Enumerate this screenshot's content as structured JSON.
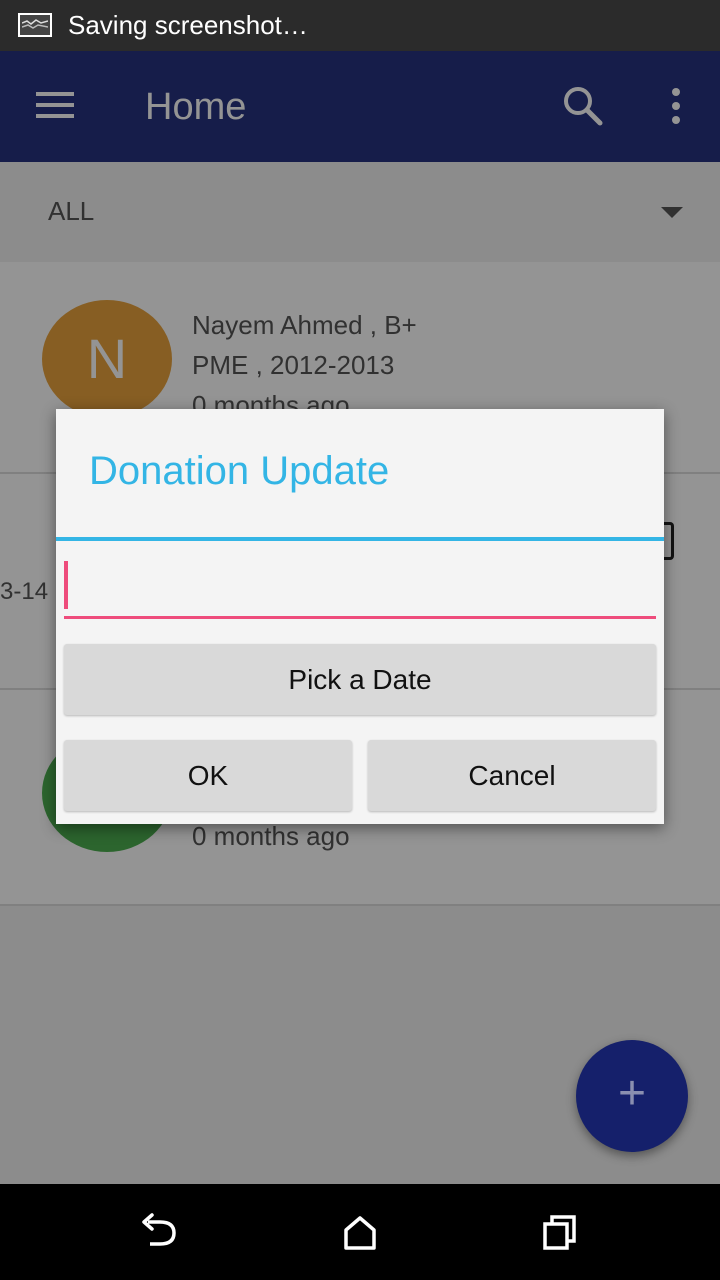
{
  "status_bar": {
    "text": "Saving screenshot…",
    "icon": "screenshot-icon"
  },
  "app_bar": {
    "title": "Home",
    "icons": [
      "menu-icon",
      "search-icon",
      "more-vert-icon"
    ],
    "color": "#263380"
  },
  "filter": {
    "label": "ALL"
  },
  "list": {
    "items": [
      {
        "initial": "N",
        "avatar_color": "#e8a33d",
        "line1": "Nayem Ahmed , B+",
        "line2": "PME , 2012-2013",
        "line3": "0 months  ago"
      },
      {
        "partial_text": "3-14"
      },
      {
        "avatar_color": "#4caf50",
        "line3": "0 months  ago"
      }
    ]
  },
  "dialog": {
    "title": "Donation Update",
    "input_value": "",
    "pick_date_label": "Pick a Date",
    "ok_label": "OK",
    "cancel_label": "Cancel",
    "accent_color": "#33b5e5",
    "input_color": "#ee4c7c"
  },
  "fab": {
    "label": "+"
  },
  "nav_bar": {
    "icons": [
      "back-icon",
      "home-icon",
      "recents-icon"
    ]
  }
}
